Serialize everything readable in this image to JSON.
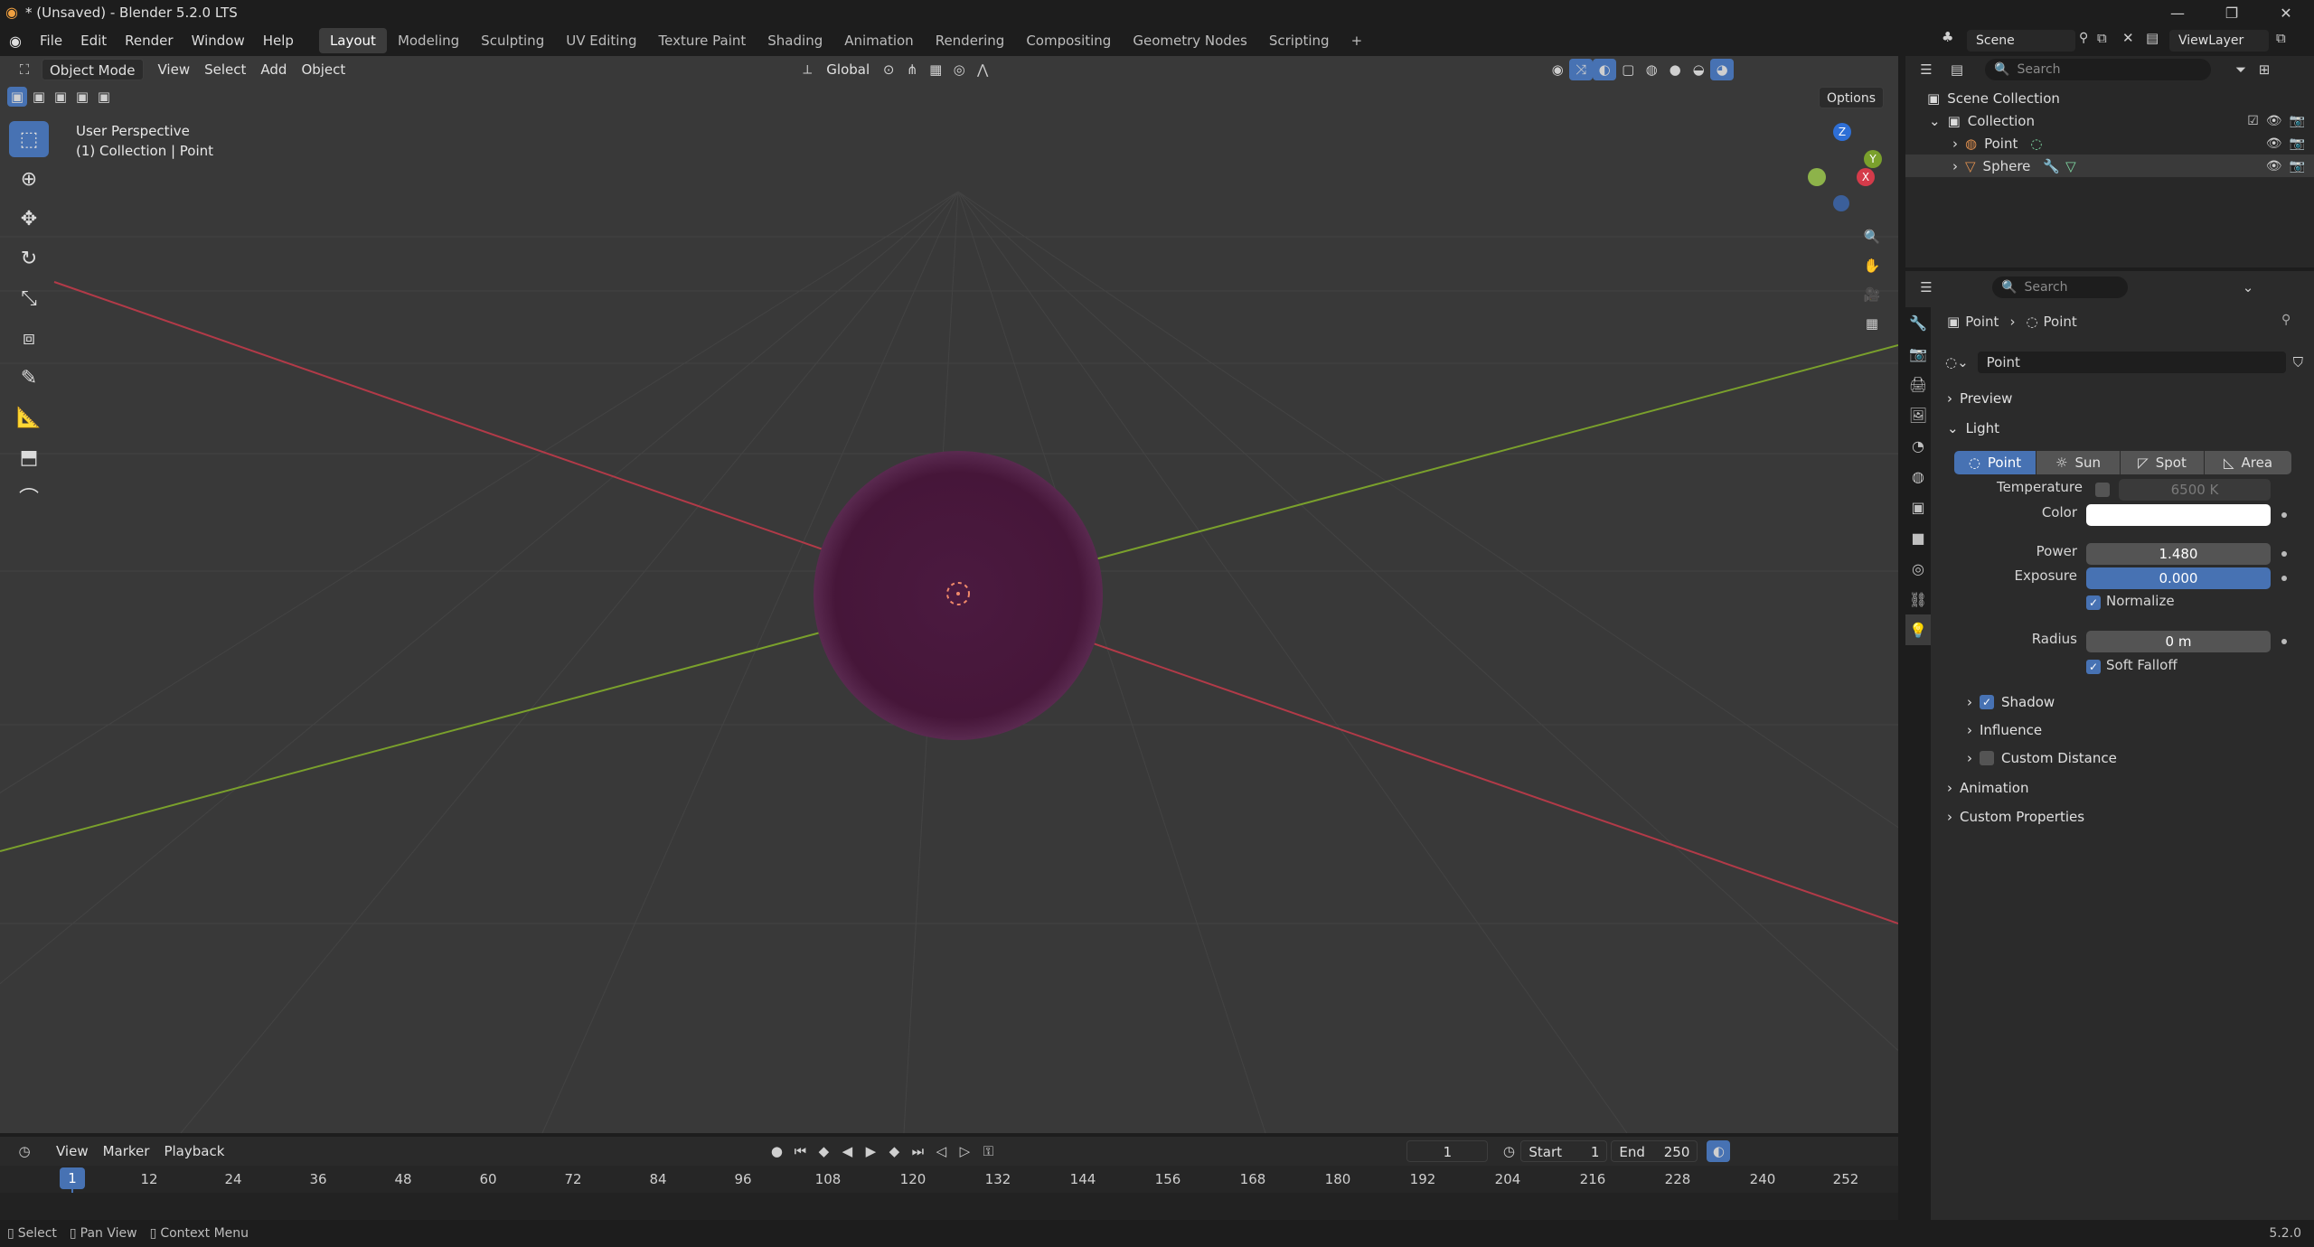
{
  "window": {
    "title": "* (Unsaved) - Blender 5.2.0 LTS",
    "minimize": "—",
    "maximize": "❐",
    "close": "✕"
  },
  "menus": [
    "File",
    "Edit",
    "Render",
    "Window",
    "Help"
  ],
  "workspaces": [
    "Layout",
    "Modeling",
    "Sculpting",
    "UV Editing",
    "Texture Paint",
    "Shading",
    "Animation",
    "Rendering",
    "Compositing",
    "Geometry Nodes",
    "Scripting"
  ],
  "workspace_add": "+",
  "scene": {
    "name": "Scene",
    "view_layer": "ViewLayer"
  },
  "viewport": {
    "mode": "Object Mode",
    "menus": [
      "View",
      "Select",
      "Add",
      "Object"
    ],
    "transform_orientation": "Global",
    "options_label": "Options",
    "info_line1": "User Perspective",
    "info_line2": "(1) Collection | Point",
    "gizmo_axes": [
      "Z",
      "Y",
      "X"
    ]
  },
  "outliner": {
    "search_placeholder": "Search",
    "root": "Scene Collection",
    "collection": "Collection",
    "items": [
      {
        "name": "Point"
      },
      {
        "name": "Sphere"
      }
    ]
  },
  "properties": {
    "search_placeholder": "Search",
    "breadcrumb": [
      "Point",
      "Point"
    ],
    "datablock_name": "Point",
    "panels": {
      "preview": "Preview",
      "light": "Light",
      "shadow": "Shadow",
      "influence": "Influence",
      "custom_distance": "Custom Distance",
      "animation": "Animation",
      "custom_properties": "Custom Properties"
    },
    "light_types": [
      "Point",
      "Sun",
      "Spot",
      "Area"
    ],
    "active_light_type": "Point",
    "temperature_label": "Temperature",
    "temperature_value": "6500 K",
    "color_label": "Color",
    "color_value": "#ffffff",
    "power_label": "Power",
    "power_value": "1.480",
    "exposure_label": "Exposure",
    "exposure_value": "0.000",
    "normalize_label": "Normalize",
    "radius_label": "Radius",
    "radius_value": "0 m",
    "soft_falloff_label": "Soft Falloff"
  },
  "timeline": {
    "menus": [
      "View",
      "Marker",
      "Playback"
    ],
    "current_frame": "1",
    "start_label": "Start",
    "start_value": "1",
    "end_label": "End",
    "end_value": "250",
    "ruler": [
      "1",
      "12",
      "24",
      "36",
      "48",
      "60",
      "72",
      "84",
      "96",
      "108",
      "120",
      "132",
      "144",
      "156",
      "168",
      "180",
      "192",
      "204",
      "216",
      "228",
      "240",
      "252"
    ]
  },
  "status": {
    "select": "Select",
    "pan": "Pan View",
    "context": "Context Menu",
    "version": "5.2.0"
  },
  "colors": {
    "accent": "#4772b3",
    "sphere": "#4a1a3d",
    "x_axis": "#b23a48",
    "y_axis": "#7aa02c"
  }
}
